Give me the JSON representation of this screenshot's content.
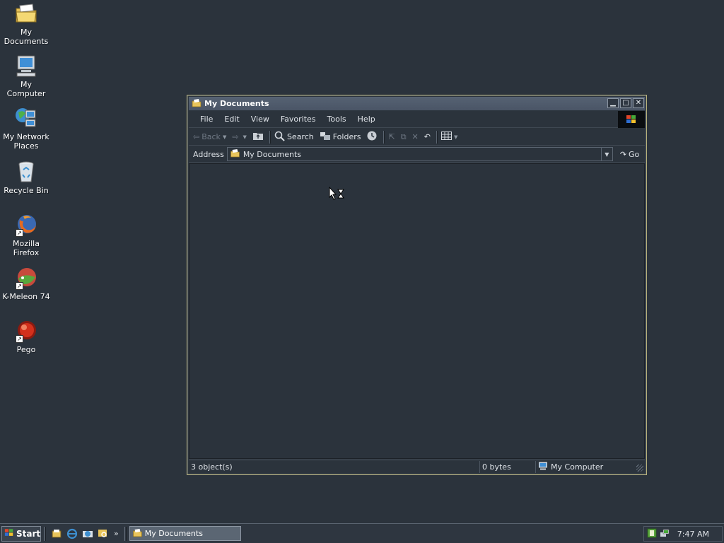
{
  "desktop": {
    "icons": [
      {
        "label": "My Documents",
        "icon": "folder-documents-icon"
      },
      {
        "label": "My Computer",
        "icon": "computer-icon"
      },
      {
        "label": "My Network Places",
        "icon": "network-icon"
      },
      {
        "label": "Recycle Bin",
        "icon": "recycle-bin-icon"
      },
      {
        "label": "Mozilla Firefox",
        "icon": "firefox-icon"
      },
      {
        "label": "K-Meleon 74",
        "icon": "kmeleon-icon"
      },
      {
        "label": "Pego",
        "icon": "pego-icon"
      }
    ]
  },
  "window": {
    "title": "My Documents",
    "menu": [
      "File",
      "Edit",
      "View",
      "Favorites",
      "Tools",
      "Help"
    ],
    "toolbar": {
      "back": "Back",
      "search": "Search",
      "folders": "Folders"
    },
    "address": {
      "label": "Address",
      "value": "My Documents",
      "go": "Go"
    },
    "status": {
      "objects": "3 object(s)",
      "size": "0 bytes",
      "location": "My Computer"
    }
  },
  "taskbar": {
    "start": "Start",
    "more": "»",
    "task": "My Documents",
    "clock": "7:47 AM"
  },
  "colors": {
    "desktop": "#2b333c",
    "titlebar": "#566273",
    "window_border": "#b8b17a"
  }
}
